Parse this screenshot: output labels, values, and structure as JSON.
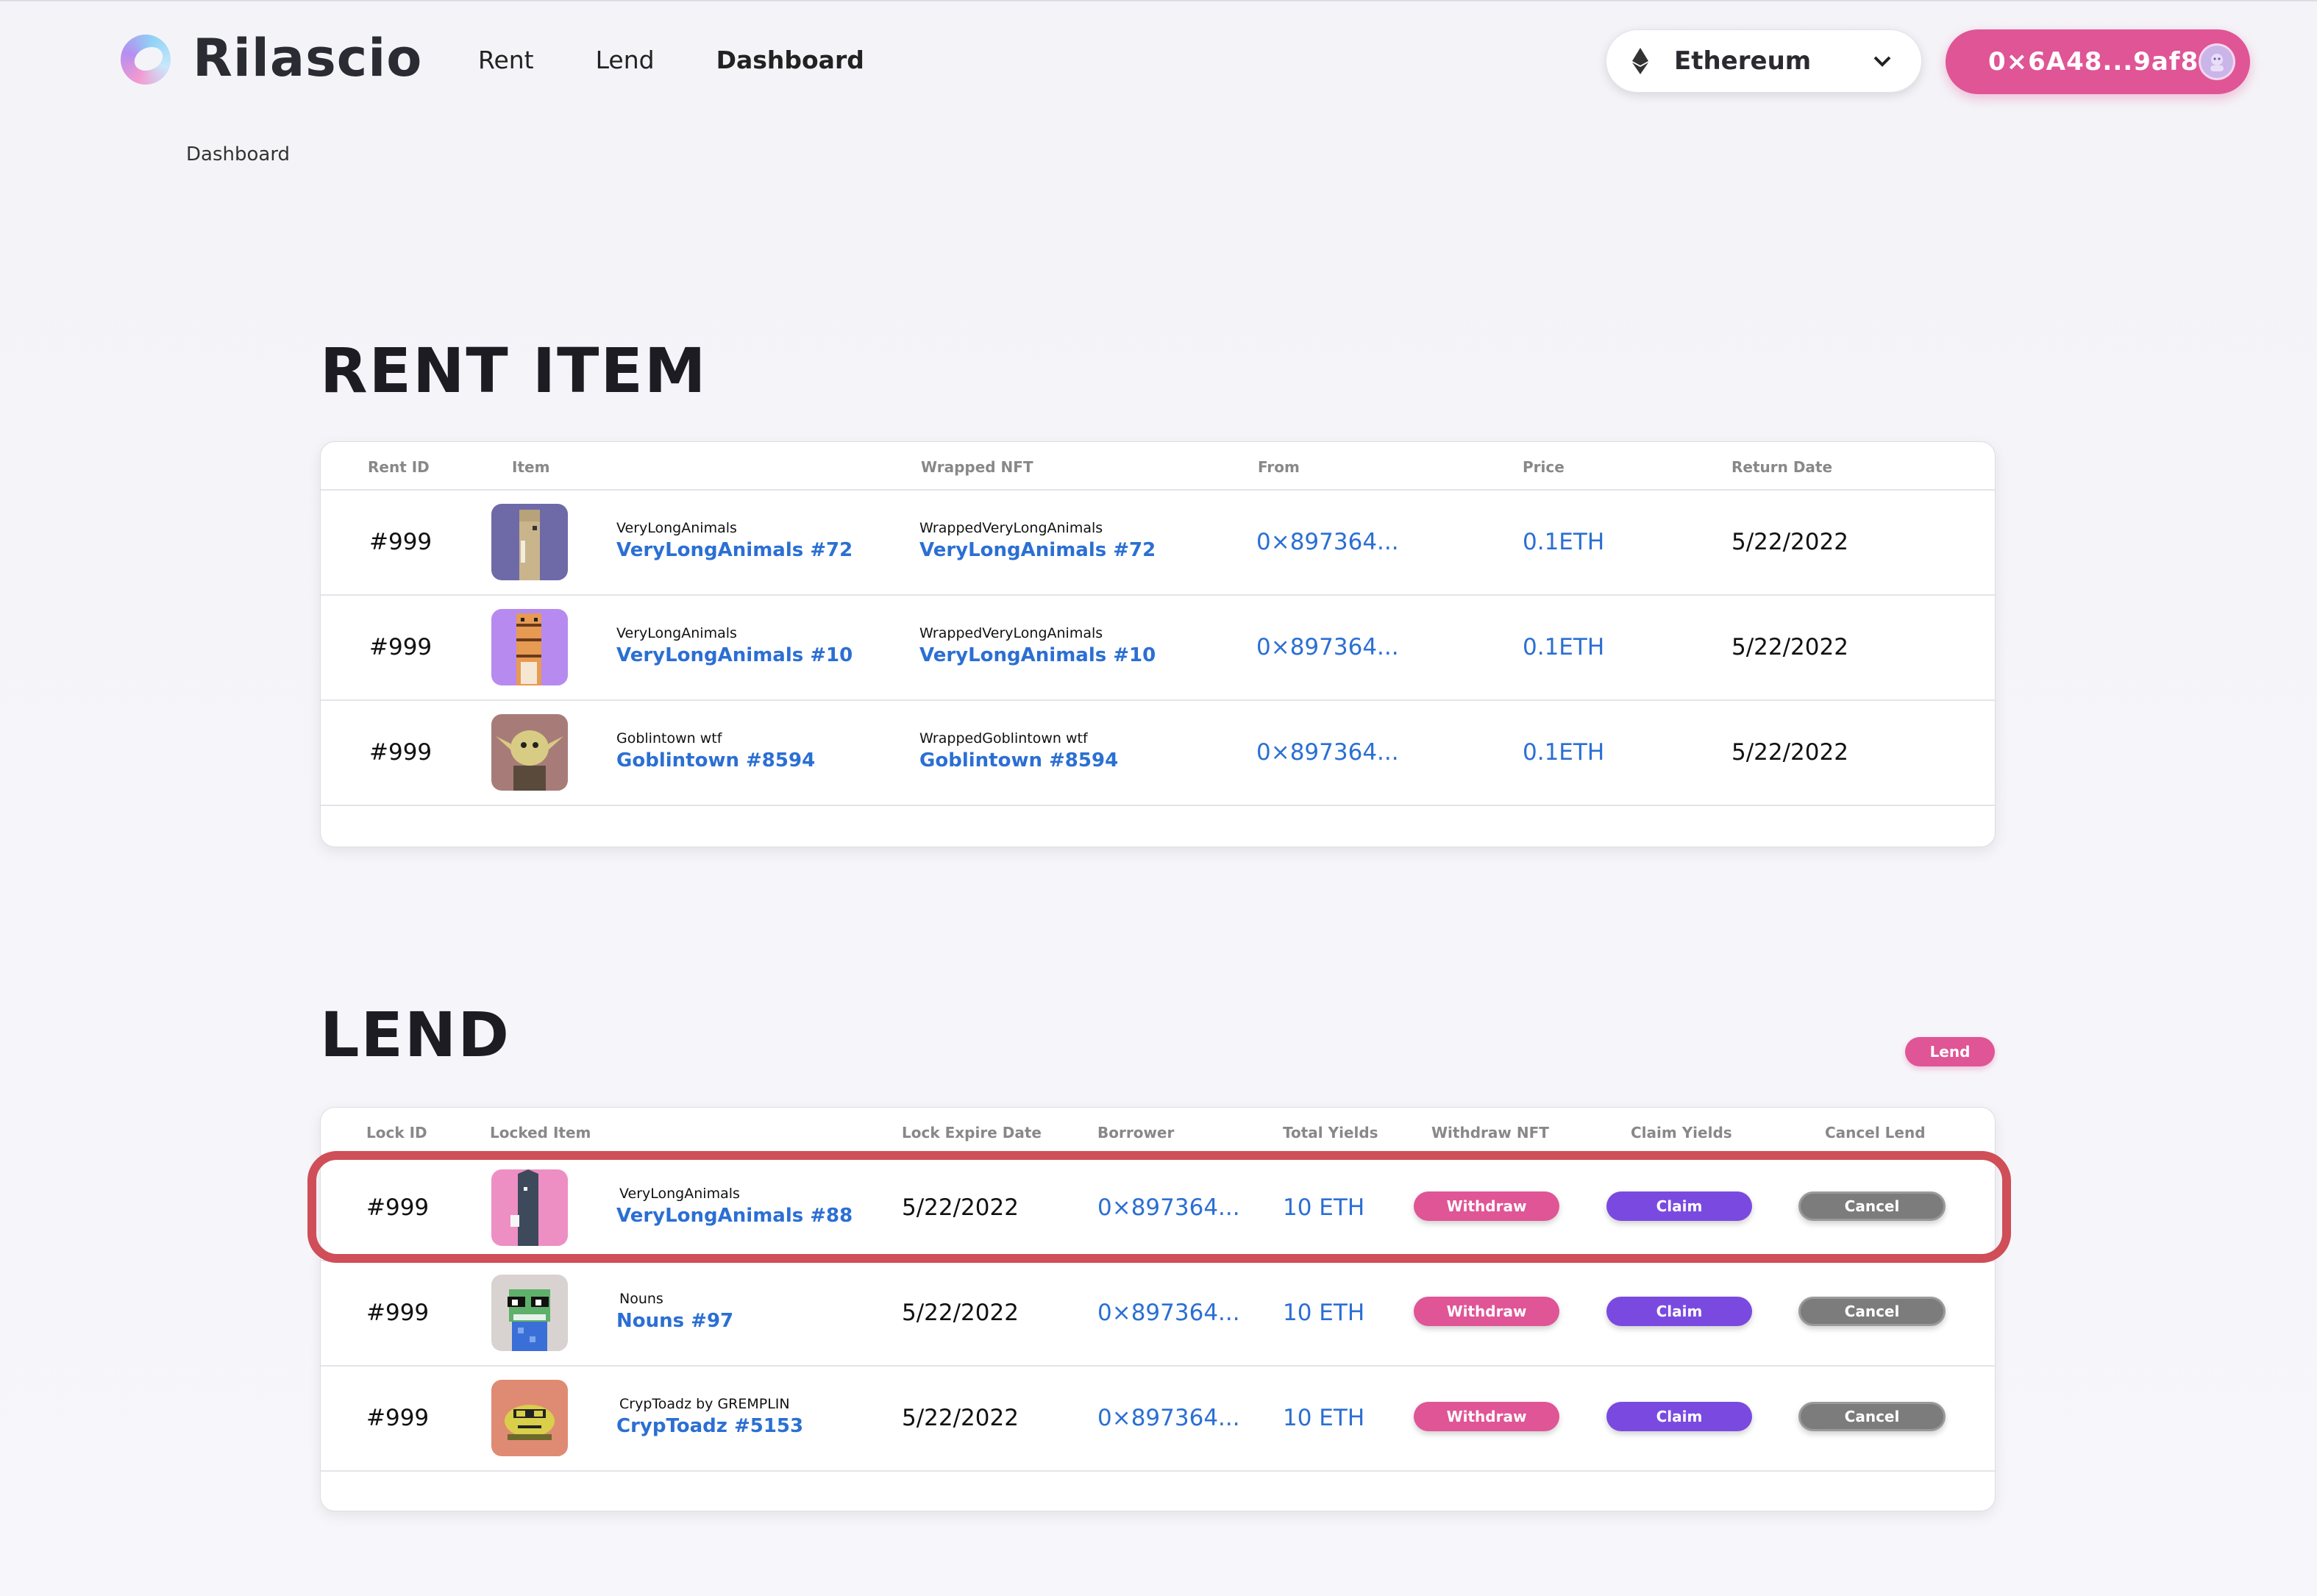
{
  "header": {
    "brand": "Rilascio",
    "nav": [
      {
        "label": "Rent",
        "active": false
      },
      {
        "label": "Lend",
        "active": false
      },
      {
        "label": "Dashboard",
        "active": true
      }
    ],
    "network": {
      "label": "Ethereum",
      "icon": "ethereum-icon"
    },
    "wallet": {
      "address": "0×6A48...9af8",
      "icon": "avatar-icon"
    }
  },
  "breadcrumb": "Dashboard",
  "rent": {
    "title": "RENT ITEM",
    "columns": [
      "Rent ID",
      "Item",
      "Wrapped NFT",
      "From",
      "Price",
      "Return Date"
    ],
    "rows": [
      {
        "id": "#999",
        "collection": "VeryLongAnimals",
        "name": "VeryLongAnimals #72",
        "wrapped_collection": "WrappedVeryLongAnimals",
        "wrapped_name": "VeryLongAnimals #72",
        "from": "0×897364...",
        "price": "0.1ETH",
        "return_date": "5/22/2022",
        "thumb_bg": "#6e6aa8"
      },
      {
        "id": "#999",
        "collection": "VeryLongAnimals",
        "name": "VeryLongAnimals #10",
        "wrapped_collection": "WrappedVeryLongAnimals",
        "wrapped_name": "VeryLongAnimals #10",
        "from": "0×897364...",
        "price": "0.1ETH",
        "return_date": "5/22/2022",
        "thumb_bg": "#b78af0"
      },
      {
        "id": "#999",
        "collection": "Goblintown wtf",
        "name": "Goblintown #8594",
        "wrapped_collection": "WrappedGoblintown wtf",
        "wrapped_name": "Goblintown #8594",
        "from": "0×897364...",
        "price": "0.1ETH",
        "return_date": "5/22/2022",
        "thumb_bg": "#a77c78"
      }
    ]
  },
  "lend": {
    "title": "LEND",
    "lend_button": "Lend",
    "columns": [
      "Lock ID",
      "Locked Item",
      "Lock Expire Date",
      "Borrower",
      "Total Yields",
      "Withdraw NFT",
      "Claim Yields",
      "Cancel Lend"
    ],
    "rows": [
      {
        "id": "#999",
        "collection": "VeryLongAnimals",
        "name": "VeryLongAnimals #88",
        "expire": "5/22/2022",
        "borrower": "0×897364...",
        "yields": "10 ETH",
        "withdraw": "Withdraw",
        "claim": "Claim",
        "cancel": "Cancel",
        "thumb_bg": "#ee8fc4",
        "highlighted": true
      },
      {
        "id": "#999",
        "collection": "Nouns",
        "name": "Nouns #97",
        "expire": "5/22/2022",
        "borrower": "0×897364...",
        "yields": "10 ETH",
        "withdraw": "Withdraw",
        "claim": "Claim",
        "cancel": "Cancel",
        "thumb_bg": "#d8d3d0",
        "highlighted": false
      },
      {
        "id": "#999",
        "collection": "CrypToadz by GREMPLIN",
        "name": "CrypToadz #5153",
        "expire": "5/22/2022",
        "borrower": "0×897364...",
        "yields": "10 ETH",
        "withdraw": "Withdraw",
        "claim": "Claim",
        "cancel": "Cancel",
        "thumb_bg": "#df8a72",
        "highlighted": false
      }
    ]
  },
  "colors": {
    "accent_pink": "#df5596",
    "accent_purple": "#7a4ae0",
    "link_blue": "#2b6fd3",
    "highlight_red": "#cf4e57"
  }
}
